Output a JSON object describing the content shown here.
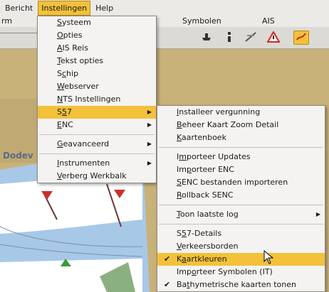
{
  "menubar": {
    "items": [
      "Bericht",
      "Instellingen",
      "Help"
    ]
  },
  "ribbon": {
    "left": "rm",
    "tab1": "Symbolen",
    "tab2": "AIS"
  },
  "map": {
    "label": "Dodev"
  },
  "colors": {
    "highlight": "#f3c13a",
    "menu_bg": "#f4f3f1",
    "water": "#ffffff",
    "shallow": "#a8c8e8",
    "land": "#c8b27a"
  },
  "instellingen_menu": {
    "items": [
      {
        "pre": "",
        "u": "S",
        "post": "ysteem"
      },
      {
        "pre": "",
        "u": "O",
        "post": "pties"
      },
      {
        "pre": "",
        "u": "A",
        "post": "IS Reis"
      },
      {
        "pre": "",
        "u": "T",
        "post": "ekst opties"
      },
      {
        "pre": "S",
        "u": "c",
        "post": "hip"
      },
      {
        "pre": "",
        "u": "W",
        "post": "ebserver"
      },
      {
        "pre": "",
        "u": "N",
        "post": "TS Instellingen"
      },
      {
        "pre": "S",
        "u": "5",
        "post": "7"
      },
      {
        "pre": "",
        "u": "E",
        "post": "NC"
      },
      {
        "pre": "",
        "u": "G",
        "post": "eavanceerd"
      },
      {
        "pre": "",
        "u": "I",
        "post": "nstrumenten"
      },
      {
        "pre": "",
        "u": "V",
        "post": "erberg Werkbalk"
      }
    ]
  },
  "s57_menu": {
    "items": [
      {
        "pre": "",
        "u": "I",
        "post": "nstalleer vergunning"
      },
      {
        "pre": "",
        "u": "B",
        "post": "eheer Kaart Zoom Detail"
      },
      {
        "pre": "",
        "u": "K",
        "post": "aartenboek"
      },
      {
        "pre": "I",
        "u": "m",
        "post": "porteer Updates"
      },
      {
        "pre": "Im",
        "u": "p",
        "post": "orteer ENC"
      },
      {
        "pre": "",
        "u": "S",
        "post": "ENC bestanden importeren"
      },
      {
        "pre": "",
        "u": "R",
        "post": "ollback SENC"
      },
      {
        "pre": "",
        "u": "T",
        "post": "oon laatste log"
      },
      {
        "pre": "S",
        "u": "5",
        "post": "7-Details"
      },
      {
        "pre": "",
        "u": "V",
        "post": "erkeersborden"
      },
      {
        "pre": "K",
        "u": "a",
        "post": "artkleuren"
      },
      {
        "pre": "Imp",
        "u": "o",
        "post": "rteer Symbolen (IT)"
      },
      {
        "pre": "Ba",
        "u": "t",
        "post": "hymetrische kaarten tonen"
      }
    ]
  }
}
